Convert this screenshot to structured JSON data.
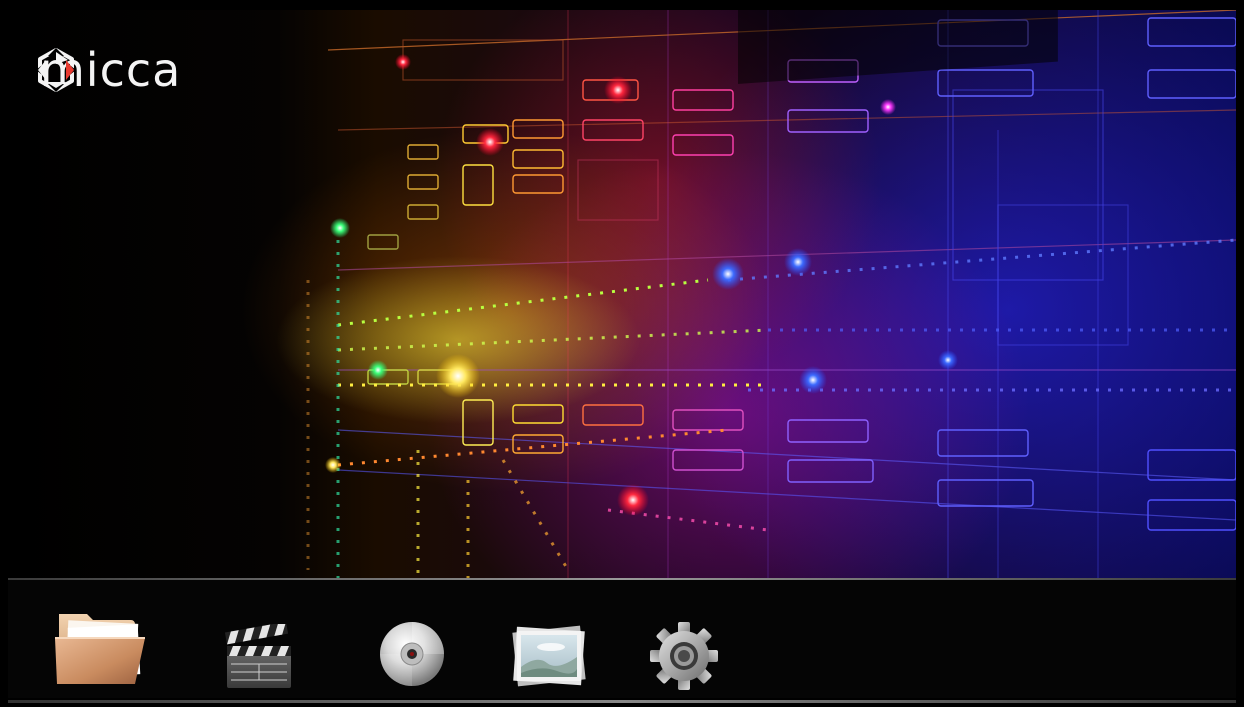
{
  "brand": {
    "name": "micca"
  },
  "dock": {
    "items": [
      {
        "id": "file-browser",
        "icon": "folder-icon"
      },
      {
        "id": "movies",
        "icon": "clapperboard-icon"
      },
      {
        "id": "music",
        "icon": "disc-icon"
      },
      {
        "id": "photos",
        "icon": "photos-icon"
      },
      {
        "id": "settings",
        "icon": "gear-icon"
      }
    ]
  },
  "colors": {
    "background": "#000000",
    "logo_accent": "#e8392f",
    "folder_tan": "#d9a77f",
    "gear_gray": "#a9a9a9"
  }
}
